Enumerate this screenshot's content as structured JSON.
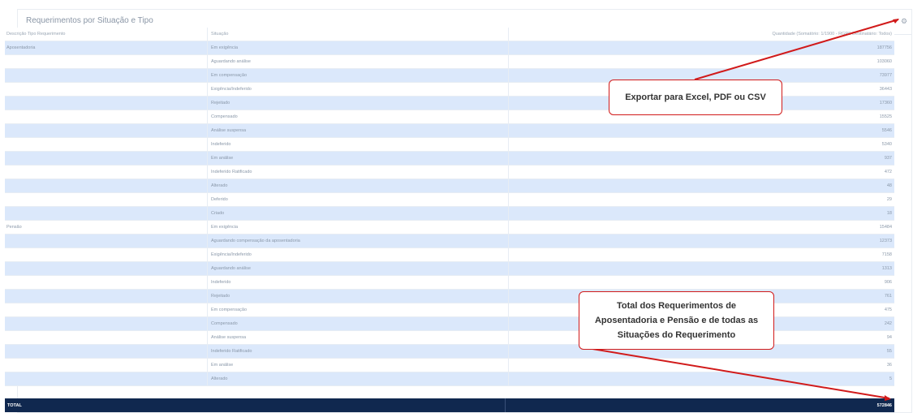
{
  "panel": {
    "title": "Requerimentos por Situação e Tipo"
  },
  "table": {
    "headers": [
      "Descrição Tipo Requerimento",
      "Situação",
      "Quantidade (Somatório: 1/1900 - RGPS Destinatário: Todos)"
    ],
    "rows": [
      [
        "Aposentadoria",
        "Em exigência",
        "187756"
      ],
      [
        "",
        "Aguardando análise",
        "103060"
      ],
      [
        "",
        "Em compensação",
        "73977"
      ],
      [
        "",
        "Exigência/Indeferido",
        "36443"
      ],
      [
        "",
        "Rejeitado",
        "17360"
      ],
      [
        "",
        "Compensado",
        "15525"
      ],
      [
        "",
        "Análise suspensa",
        "5546"
      ],
      [
        "",
        "Indeferido",
        "5340"
      ],
      [
        "",
        "Em análise",
        "937"
      ],
      [
        "",
        "Indeferido Ratificado",
        "472"
      ],
      [
        "",
        "Alterado",
        "48"
      ],
      [
        "",
        "Deferido",
        "29"
      ],
      [
        "",
        "Criado",
        "18"
      ],
      [
        "Pensão",
        "Em exigência",
        "15484"
      ],
      [
        "",
        "Aguardando compensação da aposentadoria",
        "12373"
      ],
      [
        "",
        "Exigência/Indeferido",
        "7158"
      ],
      [
        "",
        "Aguardando análise",
        "1313"
      ],
      [
        "",
        "Indeferido",
        "906"
      ],
      [
        "",
        "Rejeitado",
        "761"
      ],
      [
        "",
        "Em compensação",
        "475"
      ],
      [
        "",
        "Compensado",
        "242"
      ],
      [
        "",
        "Análise suspensa",
        "94"
      ],
      [
        "",
        "Indeferido Ratificado",
        "55"
      ],
      [
        "",
        "Em análise",
        "36"
      ],
      [
        "",
        "Alterado",
        "5"
      ]
    ],
    "total": {
      "label": "TOTAL",
      "value": "572846"
    }
  },
  "annotations": {
    "export": "Exportar para Excel, PDF ou CSV",
    "total_note": "Total dos Requerimentos de Aposentadoria e Pensão e de todas as Situações do Requerimento"
  },
  "icons": {
    "settings": "gear-icon"
  },
  "colors": {
    "total_bar": "#10284f",
    "row_alt": "#dbe8fb",
    "annotation": "#d11a1a"
  }
}
